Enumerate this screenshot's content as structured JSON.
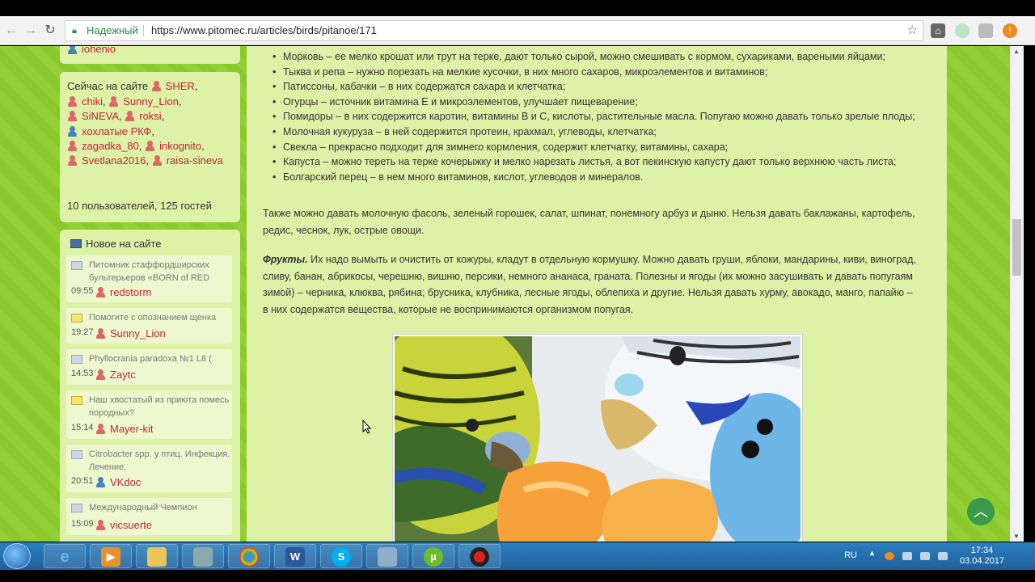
{
  "browser": {
    "secure_label": "Надежный",
    "url": "https://www.pitomec.ru/articles/birds/pitanoe/171"
  },
  "sidebar": {
    "top_user": "iohenio",
    "online": {
      "heading": "Сейчас на сайте",
      "users": [
        "SHER",
        "chiki",
        "Sunny_Lion",
        "SiNEVA",
        "roksi",
        "хохлатые РКФ",
        "zagadka_80",
        "inkognito",
        "Svetlana2016",
        "raisa-sineva"
      ],
      "summary": "10 пользователей, 125 гостей"
    },
    "new": {
      "heading": "Новое на сайте",
      "items": [
        {
          "topic": "Питомник стаффордширских бультерьеров «BORN of RED",
          "time": "09:55",
          "user": "redstorm"
        },
        {
          "topic": "Помогите с опознанием щенка",
          "time": "19:27",
          "user": "Sunny_Lion"
        },
        {
          "topic": "Phyllocrania paradoxa №1 L8 (",
          "time": "14:53",
          "user": "Zaytc"
        },
        {
          "topic": "Наш хвостатый из приюта помесь породных?",
          "time": "15:14",
          "user": "Mayer-kit"
        },
        {
          "topic": "Citrobacter spp. у птиц. Инфекция. Лечение.",
          "time": "20:51",
          "user": "VKdoc"
        },
        {
          "topic": "Международный Чемпион",
          "time": "15:09",
          "user": "vicsuerte"
        }
      ]
    }
  },
  "article": {
    "vegetables": [
      "Морковь – ее мелко крошат или трут на терке, дают только сырой, можно смешивать с кормом, сухариками, вареными яйцами;",
      "Тыква и репа – нужно порезать на мелкие кусочки, в них много сахаров, микроэлементов и витаминов;",
      "Патиссоны, кабачки – в них содержатся сахара и клетчатка;",
      "Огурцы – источник витамина Е и микроэлементов, улучшает пищеварение;",
      "Помидоры – в них содержится каротин, витамины В и С, кислоты, растительные масла. Попугаю можно давать только зрелые плоды;",
      "Молочная кукуруза – в ней содержится протеин, крахмал, углеводы, клетчатка;",
      "Свекла – прекрасно подходит для зимнего кормления, содержит клетчатку, витамины, сахара;",
      "Капуста – можно тереть на терке кочерыжку и мелко нарезать листья, а вот пекинскую капусту дают только верхнюю часть листа;",
      "Болгарский перец – в нем много витаминов, кислот, углеводов и минералов."
    ],
    "also": "Также можно давать молочную фасоль, зеленый горошек, салат, шпинат, понемногу арбуз и дыню. Нельзя давать баклажаны, картофель, редис, чеснок, лук, острые овощи.",
    "fruits_label": "Фрукты.",
    "fruits_text": " Их надо вымыть и очистить от кожуры, кладут в отдельную кормушку. Можно давать груши, яблоки, мандарины, киви, виноград, сливу, банан, абрикосы, черешню, вишню, персики, немного ананаса, граната. Полезны и ягоды (их можно засушивать и давать попугаям зимой) – черника, клюква, рябина, брусника, клубника, лесные ягоды, облепиха и другие. Нельзя давать хурму, авокадо, манго, папайю – в них содержатся вещества, которые не воспринимаются организмом попугая."
  },
  "taskbar": {
    "lang": "RU",
    "time": "17:34",
    "date": "03.04.2017"
  }
}
